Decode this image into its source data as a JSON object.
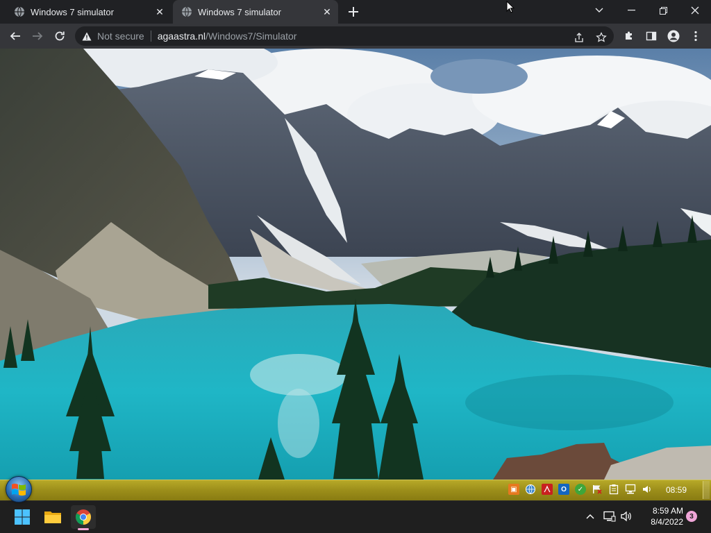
{
  "browser": {
    "tabs": [
      {
        "title": "Windows 7 simulator",
        "active": false
      },
      {
        "title": "Windows 7 simulator",
        "active": true
      }
    ],
    "new_tab_icon": "plus-icon",
    "window_controls": [
      "chevron-down-icon",
      "minimize-icon",
      "restore-icon",
      "close-icon"
    ],
    "toolbar": {
      "back_icon": "back-arrow-icon",
      "forward_icon": "forward-arrow-icon",
      "reload_icon": "reload-icon",
      "security_text": "Not secure",
      "url_host": "agaastra.nl",
      "url_path": "/Windows7/Simulator",
      "right_icons": [
        "share-icon",
        "bookmark-star-icon",
        "extensions-icon",
        "side-panel-icon",
        "profile-icon",
        "more-menu-icon"
      ]
    }
  },
  "simulator": {
    "wallpaper": "mountain-lake-wallpaper",
    "taskbar": {
      "start_button": "windows-7-start-orb",
      "tray_icons": [
        "app-orange-icon",
        "network-globe-icon",
        "pdf-icon",
        "outlook-icon",
        "security-check-icon",
        "flag-icon",
        "clipboard-icon",
        "network-icon",
        "volume-icon"
      ],
      "clock": "08:59",
      "accent": "#9c8e1a"
    }
  },
  "host_taskbar": {
    "pinned": [
      {
        "name": "windows-start-icon"
      },
      {
        "name": "file-explorer-icon"
      },
      {
        "name": "chrome-icon",
        "active": true
      }
    ],
    "tray": [
      "chevron-up-icon",
      "display-icon",
      "speaker-icon"
    ],
    "time": "8:59 AM",
    "date": "8/4/2022",
    "notification_count": "3"
  }
}
